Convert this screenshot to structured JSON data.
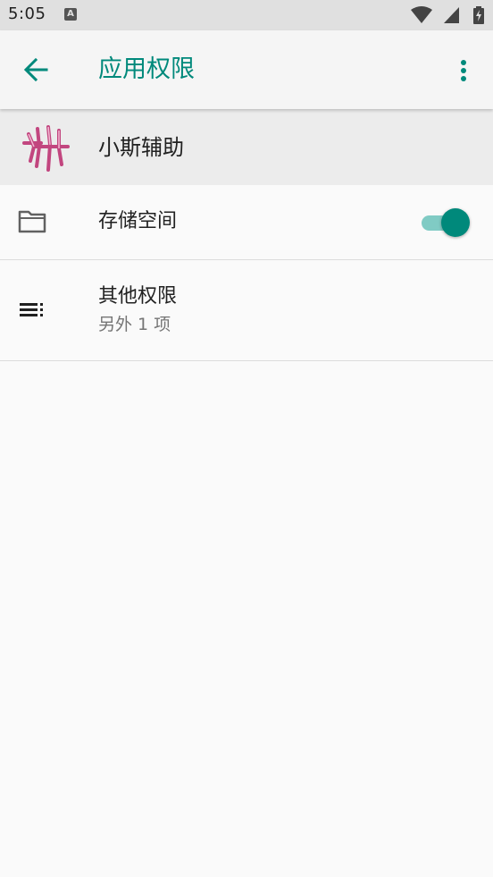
{
  "status_bar": {
    "time": "5:05",
    "notification_icon": "a-letter-icon"
  },
  "toolbar": {
    "title": "应用权限",
    "back_icon": "arrow-back-icon",
    "more_icon": "more-vert-icon",
    "accent_color": "#00897b"
  },
  "app": {
    "name": "小斯辅助"
  },
  "permissions": [
    {
      "title": "存储空间",
      "icon": "folder-icon",
      "enabled": true
    },
    {
      "title": "其他权限",
      "subtitle": "另外 1 项",
      "icon": "list-icon"
    }
  ]
}
